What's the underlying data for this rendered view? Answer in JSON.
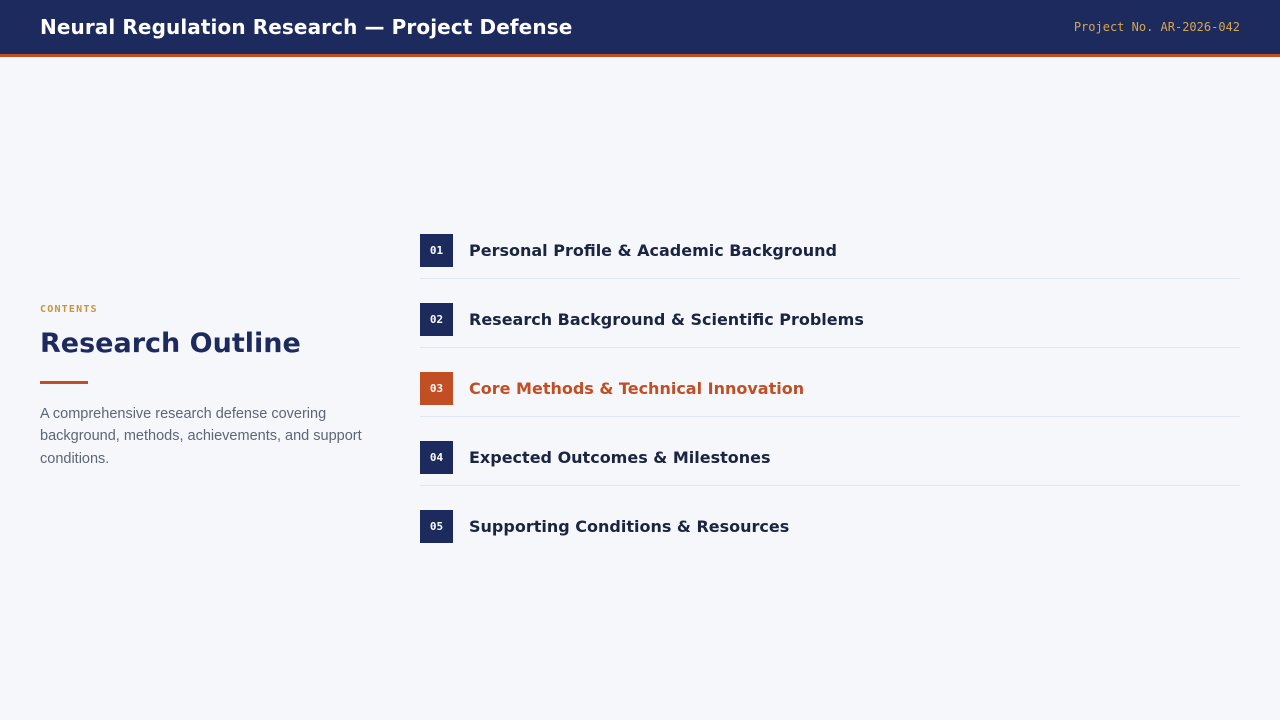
{
  "header": {
    "title": "Neural Regulation Research — Project Defense",
    "project_no": "Project No. AR-2026-042"
  },
  "outline": {
    "eyebrow": "CONTENTS",
    "title": "Research Outline",
    "description": "A comprehensive research defense covering background, methods, achievements, and support conditions."
  },
  "toc": {
    "active_index": 2,
    "items": [
      {
        "number": "01",
        "label": "Personal Profile & Academic Background"
      },
      {
        "number": "02",
        "label": "Research Background & Scientific Problems"
      },
      {
        "number": "03",
        "label": "Core Methods & Technical Innovation"
      },
      {
        "number": "04",
        "label": "Expected Outcomes & Milestones"
      },
      {
        "number": "05",
        "label": "Supporting Conditions & Resources"
      }
    ]
  },
  "colors": {
    "navy": "#1c2a5e",
    "accent": "#c24e24",
    "gold": "#c9943a",
    "background": "#f5f7fb"
  }
}
